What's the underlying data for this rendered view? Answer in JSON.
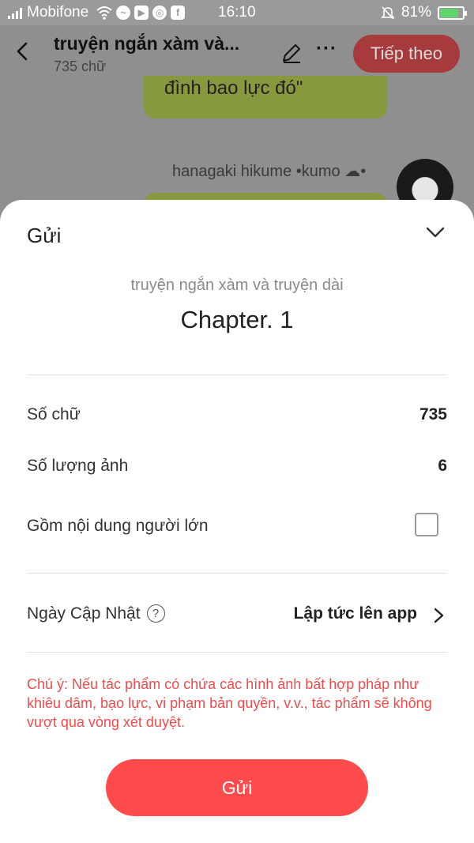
{
  "status_bar": {
    "carrier": "Mobifone",
    "time": "16:10",
    "battery": "81%",
    "battery_level": 0.81,
    "icons": [
      "signal-icon",
      "wifi-icon",
      "messenger-icon",
      "youtube-icon",
      "chrome-icon",
      "facebook-icon",
      "mute-icon",
      "battery-icon"
    ]
  },
  "header": {
    "title": "truyện ngắn xàm và...",
    "word_count": "735 chữ",
    "next_label": "Tiếp theo"
  },
  "chat": {
    "bubble_text": "đình bao lực đó\"",
    "author": "hanagaki hikume •kumo ☁•"
  },
  "sheet": {
    "title": "Gửi",
    "story_title": "truyện ngắn xàm và truyện dài",
    "chapter": "Chapter. 1",
    "rows": {
      "word_count_label": "Số chữ",
      "word_count_value": "735",
      "image_count_label": "Số lượng ảnh",
      "image_count_value": "6",
      "adult_label": "Gồm nội dung người lớn",
      "adult_checked": false,
      "update_date_label": "Ngày Cập Nhật",
      "update_date_value": "Lập tức lên app"
    },
    "notice": "Chú ý: Nếu tác phẩm có chứa các hình ảnh bất hợp pháp như khiêu dâm, bạo lực, vi phạm bản quyền, v.v., tác phẩm sẽ không vượt qua vòng xét duyệt.",
    "send_label": "Gửi"
  },
  "colors": {
    "accent": "#ff4b4b",
    "notice": "#f04b4b",
    "overlay": "#8f8f8f"
  }
}
